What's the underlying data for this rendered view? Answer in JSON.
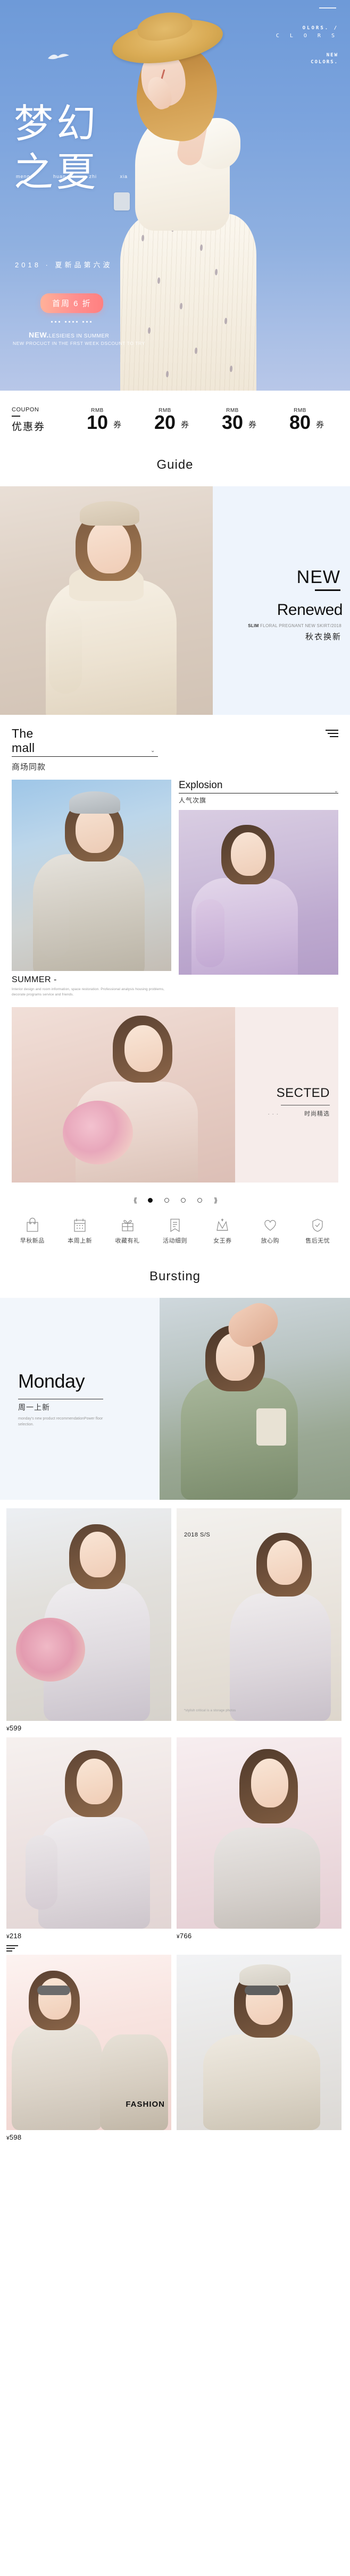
{
  "hero": {
    "top_right": {
      "line1": "OLORS.  /",
      "line2": "C L O R S",
      "line3": "NEW",
      "line4": "COLORS."
    },
    "title_line1": "梦幻",
    "title_line2": "之夏",
    "pinyin": [
      "meng",
      "huan",
      "zhi",
      "xia"
    ],
    "subtitle": "2018 · 夏新品第六波",
    "button_label": "首周 6 折",
    "tagline_strong": "NEW.",
    "tagline_rest": "LESIEIES IN SUMMER",
    "tagline_small": "NEW PROCUCT IN THE FRST WEEK DSCOUNT TO TRY"
  },
  "coupons": {
    "label_en": "COUPON",
    "label_cn": "优惠券",
    "items": [
      {
        "currency": "RMB",
        "amount": "10",
        "unit": "券"
      },
      {
        "currency": "RMB",
        "amount": "20",
        "unit": "券"
      },
      {
        "currency": "RMB",
        "amount": "30",
        "unit": "券"
      },
      {
        "currency": "RMB",
        "amount": "80",
        "unit": "券"
      }
    ]
  },
  "divider_guide": "Guide",
  "divider_bursting": "Bursting",
  "renewed": {
    "new_label": "NEW",
    "title": "Renewed",
    "sub_strong": "SLIM",
    "sub_rest": " FLORAL PREGNANT NEW SKIRT/2018",
    "cn": "秋衣换新"
  },
  "mall": {
    "title_en": "The mall",
    "title_cn": "商场同款",
    "chevron": "⌄",
    "summer_en": "SUMMER -",
    "summer_tiny": "Interior design and room information, space restoration.\nProfessional analysis housing problems, decorate programs service and friends."
  },
  "explosion": {
    "title_en": "Explosion",
    "title_cn": "人气次旗",
    "chevron": "⌄"
  },
  "sected": {
    "title_en": "SECTED",
    "dots": "· · ·",
    "cn": "时尚精选"
  },
  "carousel": {
    "prev": "⟪",
    "next": "⟫",
    "slides": 4,
    "active": 0
  },
  "icon_nav": [
    {
      "icon": "bag-icon",
      "label": "早秋新品"
    },
    {
      "icon": "calendar-icon",
      "label": "本周上新"
    },
    {
      "icon": "gift-icon",
      "label": "收藏有礼"
    },
    {
      "icon": "document-icon",
      "label": "活动细则"
    },
    {
      "icon": "crown-icon",
      "label": "女王券"
    },
    {
      "icon": "heart-icon",
      "label": "放心购"
    },
    {
      "icon": "shield-icon",
      "label": "售后无忧"
    }
  ],
  "monday": {
    "title": "Monday",
    "cn": "周一上新",
    "tiny": "monday's new product recommendationPower\nfloor selection."
  },
  "products": {
    "row1": {
      "left_price": "599",
      "right_caption": "2018 S/S",
      "right_tiny": "*stylish critical is a storage photos",
      "currency": "¥"
    },
    "row2": {
      "left_price": "218",
      "right_price": "766",
      "currency": "¥"
    },
    "row3": {
      "fashion_label": "FASHION",
      "left_price": "598",
      "currency": "¥"
    }
  }
}
